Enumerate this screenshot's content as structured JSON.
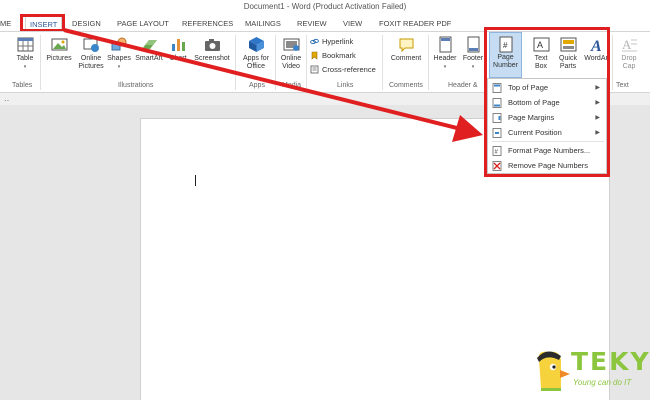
{
  "window": {
    "title": "Document1 - Word (Product Activation Failed)"
  },
  "tabs": [
    {
      "label": "ME",
      "active": false
    },
    {
      "label": "INSERT",
      "active": true
    },
    {
      "label": "DESIGN",
      "active": false
    },
    {
      "label": "PAGE LAYOUT",
      "active": false
    },
    {
      "label": "REFERENCES",
      "active": false
    },
    {
      "label": "MAILINGS",
      "active": false
    },
    {
      "label": "REVIEW",
      "active": false
    },
    {
      "label": "VIEW",
      "active": false
    },
    {
      "label": "FOXIT READER PDF",
      "active": false
    }
  ],
  "ribbon": {
    "table": {
      "label": "Table",
      "group": "Tables"
    },
    "pictures": "Pictures",
    "online_pictures": {
      "line1": "Online",
      "line2": "Pictures"
    },
    "shapes": "Shapes",
    "smartart": "SmartArt",
    "chart": "Chart",
    "screenshot": "Screenshot",
    "illustrations_group": "Illustrations",
    "apps_for_office": {
      "line1": "Apps for",
      "line2": "Office"
    },
    "apps_group": "Apps",
    "online_video": {
      "line1": "Online",
      "line2": "Video"
    },
    "media_group": "Media",
    "hyperlink": "Hyperlink",
    "bookmark": "Bookmark",
    "cross_reference": "Cross-reference",
    "links_group": "Links",
    "comment": "Comment",
    "comments_group": "Comments",
    "header": "Header",
    "footer": "Footer",
    "header_footer_group": "Header &",
    "page_number": {
      "line1": "Page",
      "line2": "Number"
    },
    "text_box": {
      "line1": "Text",
      "line2": "Box"
    },
    "quick_parts": {
      "line1": "Quick",
      "line2": "Parts"
    },
    "wordart": "WordArt",
    "drop_cap": {
      "line1": "Drop",
      "line2": "Cap"
    },
    "text_group": "Text"
  },
  "page_number_menu": {
    "items": [
      {
        "label": "Top of Page",
        "icon": "top-of-page-icon",
        "submenu": true
      },
      {
        "label": "Bottom of Page",
        "icon": "bottom-of-page-icon",
        "submenu": true
      },
      {
        "label": "Page Margins",
        "icon": "page-margins-icon",
        "submenu": true
      },
      {
        "label": "Current Position",
        "icon": "current-position-icon",
        "submenu": true
      },
      {
        "label": "Format Page Numbers...",
        "icon": "format-page-numbers-icon",
        "submenu": false
      },
      {
        "label": "Remove Page Numbers",
        "icon": "remove-page-numbers-icon",
        "submenu": false
      }
    ]
  },
  "logo": {
    "word": "TEKY",
    "tagline": "Young can do IT"
  },
  "colors": {
    "highlight": "#e02020",
    "accent": "#2b579a",
    "logo": "#8cc63f"
  }
}
